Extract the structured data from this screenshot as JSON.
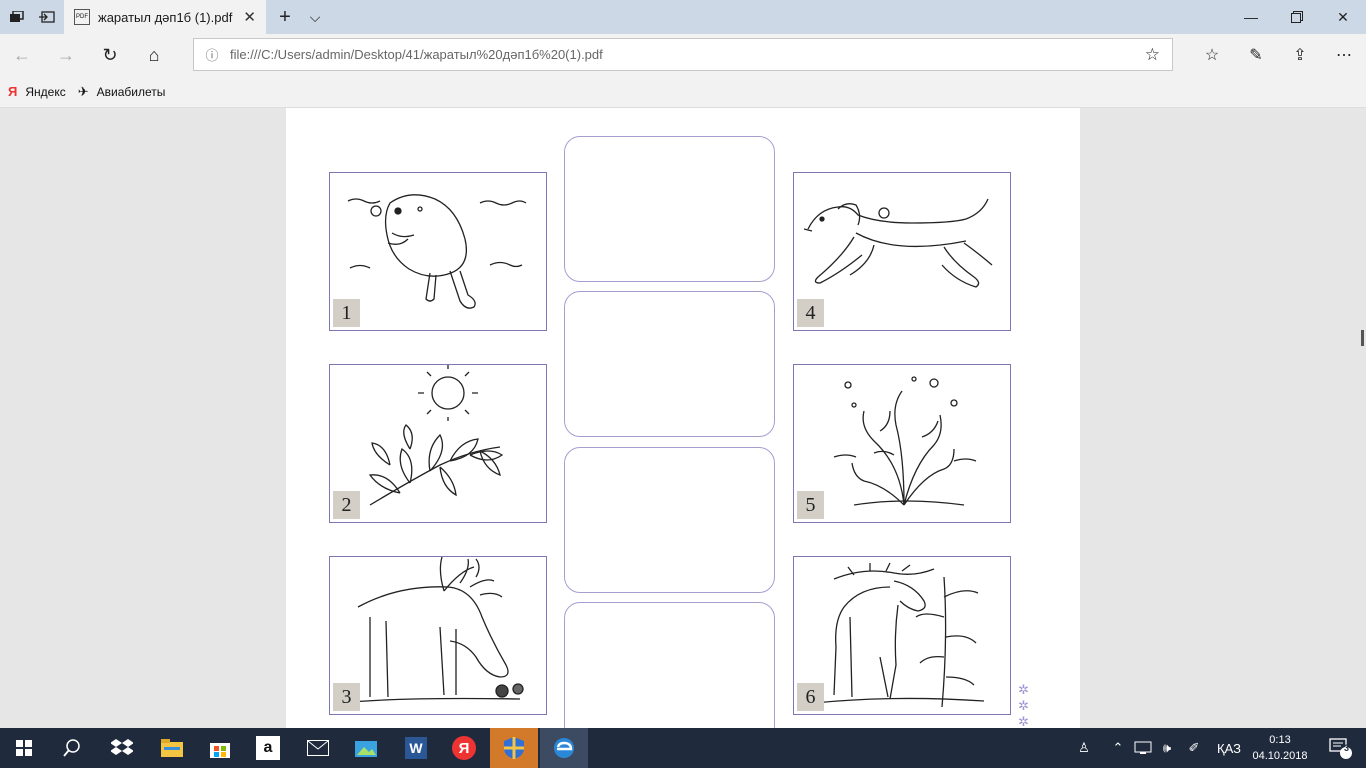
{
  "browser": {
    "tab_title": "жаратыл дәп1б (1).pdf",
    "tab_icon_text": "PDF",
    "new_tab_label": "+",
    "tab_list_label": "⌵",
    "url": "file:///C:/Users/admin/Desktop/41/жаратыл%20дәп1б%20(1).pdf",
    "favorites": [
      {
        "label": "Яндекс",
        "icon": "yandex-icon"
      },
      {
        "label": "Авиабилеты",
        "icon": "plane-icon"
      }
    ]
  },
  "worksheet": {
    "cards": [
      {
        "number": "1",
        "subject": "beaver"
      },
      {
        "number": "2",
        "subject": "sunlit-branch"
      },
      {
        "number": "3",
        "subject": "reindeer"
      },
      {
        "number": "4",
        "subject": "dog"
      },
      {
        "number": "5",
        "subject": "seaweed"
      },
      {
        "number": "6",
        "subject": "moose"
      }
    ],
    "answer_slot_count": 4
  },
  "taskbar": {
    "language": "ҚАЗ",
    "time": "0:13",
    "date": "04.10.2018",
    "notification_count": "3"
  },
  "colors": {
    "titlebar": "#cdd8e6",
    "card_border": "#7d77b5",
    "slot_border": "#a59fd0",
    "taskbar": "#1f2b3d"
  }
}
